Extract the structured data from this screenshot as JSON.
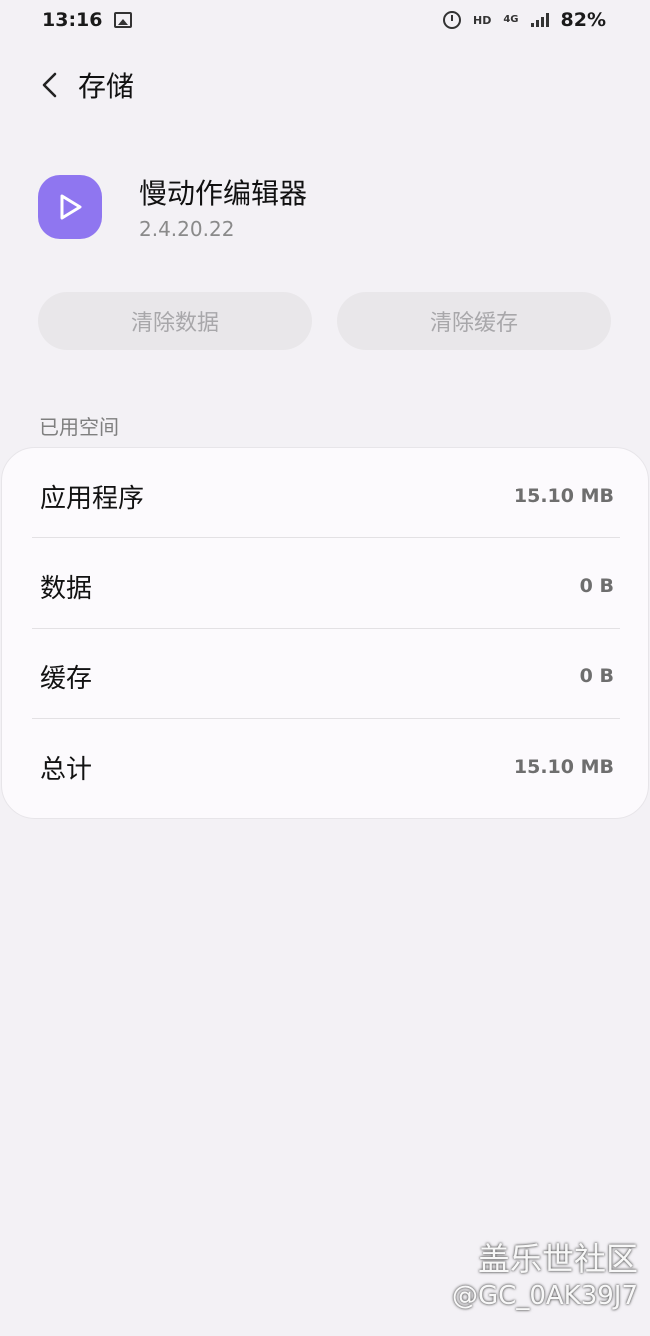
{
  "status_bar": {
    "time": "13:16",
    "hd": "HD",
    "network": "4G",
    "battery": "82%"
  },
  "header": {
    "title": "存储"
  },
  "app": {
    "name": "慢动作编辑器",
    "version": "2.4.20.22",
    "icon": "play-icon",
    "icon_color": "#8f76f0"
  },
  "actions": {
    "clear_data": "清除数据",
    "clear_cache": "清除缓存"
  },
  "storage": {
    "section_title": "已用空间",
    "rows": [
      {
        "label": "应用程序",
        "value": "15.10 MB"
      },
      {
        "label": "数据",
        "value": "0 B"
      },
      {
        "label": "缓存",
        "value": "0 B"
      },
      {
        "label": "总计",
        "value": "15.10 MB"
      }
    ]
  },
  "watermark": {
    "title": "盖乐世社区",
    "user": "@GC_0AK39J7"
  }
}
